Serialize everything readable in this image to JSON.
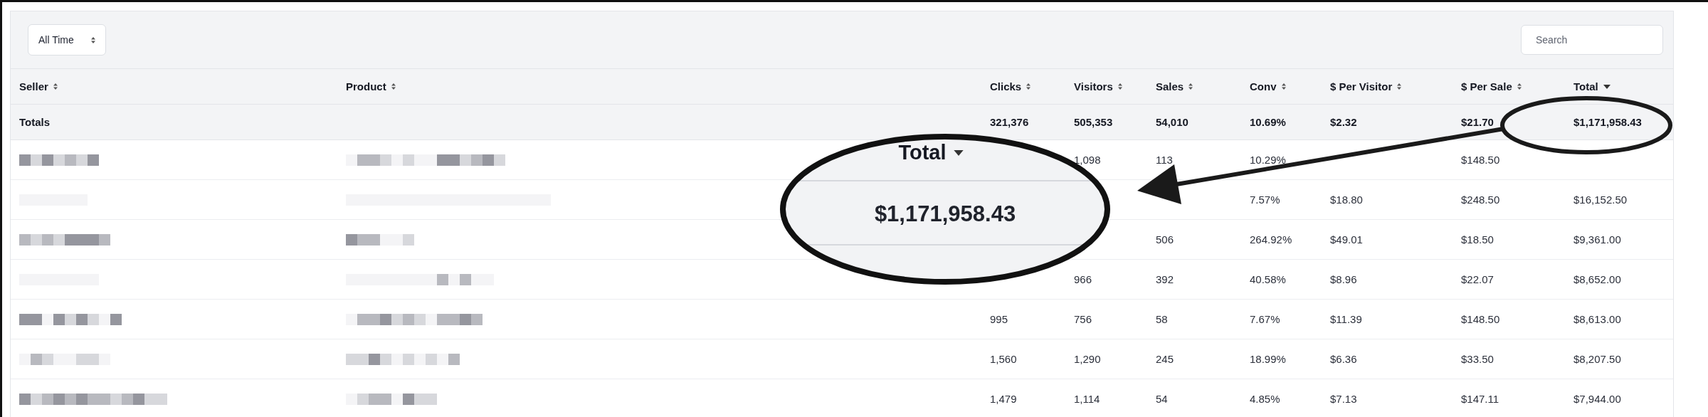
{
  "filter": {
    "value": "All Time"
  },
  "search": {
    "placeholder": "Search"
  },
  "columns": [
    {
      "label": "Seller",
      "sorted": false
    },
    {
      "label": "Product",
      "sorted": false
    },
    {
      "label": "Clicks",
      "sorted": false
    },
    {
      "label": "Visitors",
      "sorted": false
    },
    {
      "label": "Sales",
      "sorted": false
    },
    {
      "label": "Conv",
      "sorted": false
    },
    {
      "label": "$ Per Visitor",
      "sorted": false
    },
    {
      "label": "$ Per Sale",
      "sorted": false
    },
    {
      "label": "Total",
      "sorted": true
    }
  ],
  "totals": {
    "label": "Totals",
    "cells": [
      "321,376",
      "505,353",
      "54,010",
      "10.69%",
      "$2.32",
      "$21.70",
      "$1,171,958.43"
    ]
  },
  "rows": [
    {
      "cells": [
        null,
        "1,098",
        "113",
        "10.29%",
        null,
        "$148.50",
        null
      ]
    },
    {
      "cells": [
        null,
        null,
        null,
        "7.57%",
        "$18.80",
        "$248.50",
        "$16,152.50"
      ]
    },
    {
      "cells": [
        null,
        null,
        "506",
        "264.92%",
        "$49.01",
        "$18.50",
        "$9,361.00"
      ]
    },
    {
      "cells": [
        null,
        "966",
        "392",
        "40.58%",
        "$8.96",
        "$22.07",
        "$8,652.00"
      ]
    },
    {
      "cells": [
        "995",
        "756",
        "58",
        "7.67%",
        "$11.39",
        "$148.50",
        "$8,613.00"
      ]
    },
    {
      "cells": [
        "1,560",
        "1,290",
        "245",
        "18.99%",
        "$6.36",
        "$33.50",
        "$8,207.50"
      ]
    },
    {
      "cells": [
        "1,479",
        "1,114",
        "54",
        "4.85%",
        "$7.13",
        "$147.11",
        "$7,944.00"
      ]
    }
  ],
  "callout": {
    "label": "Total",
    "sorted": true,
    "value": "$1,171,958.43"
  }
}
